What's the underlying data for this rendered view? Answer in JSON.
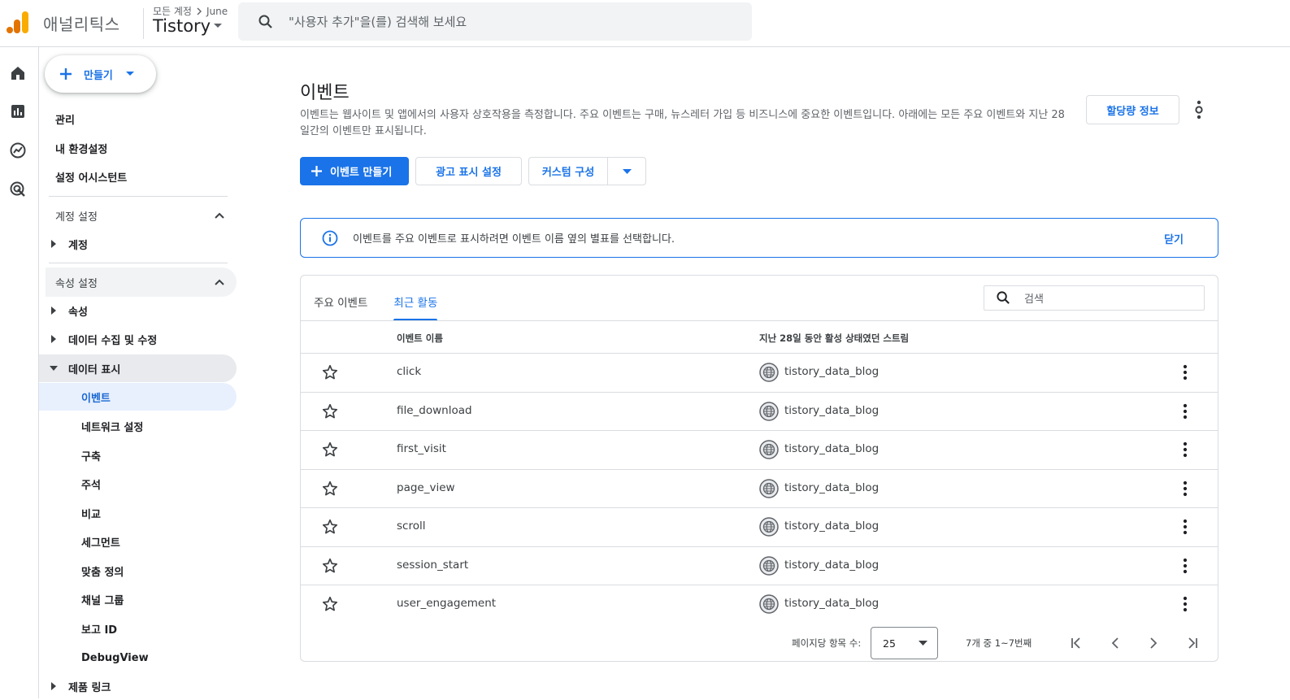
{
  "header": {
    "app_name": "애널리틱스",
    "breadcrumb_root": "모든 계정",
    "breadcrumb_account": "June",
    "property_name": "Tistory",
    "search_placeholder": "\"사용자 추가\"을(를) 검색해 보세요"
  },
  "rail": {
    "icons": [
      "home-icon",
      "reports-icon",
      "explore-icon",
      "advertising-icon"
    ]
  },
  "sidenav": {
    "create_label": "만들기",
    "top_items": [
      "관리",
      "내 환경설정",
      "설정 어시스턴트"
    ],
    "account_section": {
      "title": "계정 설정",
      "items": [
        "계정"
      ]
    },
    "property_section": {
      "title": "속성 설정",
      "items": [
        "속성",
        "데이터 수집 및 수정",
        "데이터 표시"
      ],
      "data_display_children": [
        "이벤트",
        "네트워크 설정",
        "구축",
        "주석",
        "비교",
        "세그먼트",
        "맞춤 정의",
        "채널 그룹",
        "보고 ID",
        "DebugView"
      ],
      "active_child": "이벤트",
      "more_item": "제품 링크"
    }
  },
  "main": {
    "title": "이벤트",
    "description": "이벤트는 웹사이트 및 앱에서의 사용자 상호작용을 측정합니다. 주요 이벤트는 구매, 뉴스레터 가입 등 비즈니스에 중요한 이벤트입니다. 아래에는 모든 주요 이벤트와 지난 28일간의 이벤트만 표시됩니다.",
    "quota_button": "할당량 정보",
    "create_event_button": "이벤트 만들기",
    "ad_display_button": "광고 표시 설정",
    "custom_config_button": "커스텀 구성",
    "banner": {
      "text": "이벤트를 주요 이벤트로 표시하려면 이벤트 이름 옆의 별표를 선택합니다.",
      "close": "닫기"
    },
    "tabs": [
      "주요 이벤트",
      "최근 활동"
    ],
    "active_tab": "최근 활동",
    "table_search_placeholder": "검색",
    "columns": {
      "event_name": "이벤트 이름",
      "streams": "지난 28일 동안 활성 상태였던 스트림"
    },
    "rows": [
      {
        "name": "click",
        "stream": "tistory_data_blog"
      },
      {
        "name": "file_download",
        "stream": "tistory_data_blog"
      },
      {
        "name": "first_visit",
        "stream": "tistory_data_blog"
      },
      {
        "name": "page_view",
        "stream": "tistory_data_blog"
      },
      {
        "name": "scroll",
        "stream": "tistory_data_blog"
      },
      {
        "name": "session_start",
        "stream": "tistory_data_blog"
      },
      {
        "name": "user_engagement",
        "stream": "tistory_data_blog"
      }
    ],
    "pagination": {
      "rows_per_page_label": "페이지당 항목 수:",
      "rows_per_page": "25",
      "range": "7개 중 1~7번째"
    }
  },
  "colors": {
    "accent": "#1a73e8",
    "logo_orange": "#f9ab00",
    "logo_dark": "#e37400"
  }
}
